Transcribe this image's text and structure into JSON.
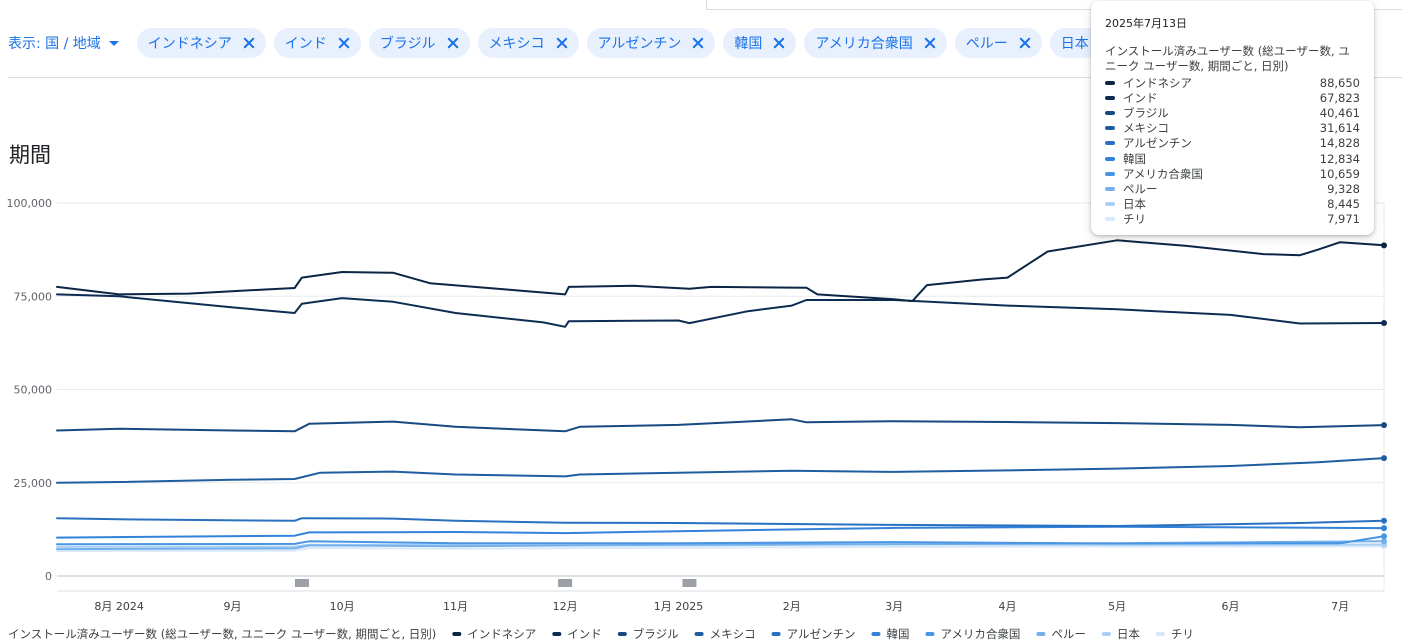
{
  "filter": {
    "dimension_label": "表示: 国 / 地域",
    "chips": [
      "インドネシア",
      "インド",
      "ブラジル",
      "メキシコ",
      "アルゼンチン",
      "韓国",
      "アメリカ合衆国",
      "ペルー",
      "日本"
    ]
  },
  "section_title": "期間",
  "tooltip": {
    "date": "2025年7月13日",
    "metric": "インストール済みユーザー数 (総ユーザー数, ユニーク ユーザー数, 期間ごと, 日別)",
    "rows": [
      {
        "name": "インドネシア",
        "value": "88,650",
        "color": "#0b2545"
      },
      {
        "name": "インド",
        "value": "67,823",
        "color": "#0d2c54"
      },
      {
        "name": "ブラジル",
        "value": "40,461",
        "color": "#174a80"
      },
      {
        "name": "メキシコ",
        "value": "31,614",
        "color": "#1f5da0"
      },
      {
        "name": "アルゼンチン",
        "value": "14,828",
        "color": "#2a70c0"
      },
      {
        "name": "韓国",
        "value": "12,834",
        "color": "#3182d8"
      },
      {
        "name": "アメリカ合衆国",
        "value": "10,659",
        "color": "#4a95e3"
      },
      {
        "name": "ペルー",
        "value": "9,328",
        "color": "#74b0ec"
      },
      {
        "name": "日本",
        "value": "8,445",
        "color": "#a9cff4"
      },
      {
        "name": "チリ",
        "value": "7,971",
        "color": "#d6e8fa"
      }
    ]
  },
  "chart_data": {
    "type": "line",
    "ylabel": "インストール済みユーザー数 (総ユーザー数, ユニーク ユーザー数, 期間ごと, 日別)",
    "ylim": [
      0,
      100000
    ],
    "yticks": [
      0,
      25000,
      50000,
      75000,
      100000
    ],
    "ytick_labels": [
      "0",
      "25,000",
      "50,000",
      "75,000",
      "100,000"
    ],
    "xlim": [
      "2024-07-15",
      "2025-07-13"
    ],
    "xticks": [
      "2024-08-01",
      "2024-09-01",
      "2024-10-01",
      "2024-11-01",
      "2024-12-01",
      "2025-01-01",
      "2025-02-01",
      "2025-03-01",
      "2025-04-01",
      "2025-05-01",
      "2025-06-01",
      "2025-07-01"
    ],
    "xtick_labels": [
      "8月 2024",
      "9月",
      "10月",
      "11月",
      "12月",
      "1月 2025",
      "2月",
      "3月",
      "4月",
      "5月",
      "6月",
      "7月"
    ],
    "annotation_dates": [
      "2024-09-20",
      "2024-12-01",
      "2025-01-04"
    ],
    "grid": true,
    "legend_position": "bottom",
    "series": [
      {
        "name": "インドネシア",
        "color": "#0b2545",
        "x": [
          "2024-07-15",
          "2024-08-01",
          "2024-08-20",
          "2024-09-10",
          "2024-09-18",
          "2024-09-20",
          "2024-10-01",
          "2024-10-15",
          "2024-10-25",
          "2024-11-15",
          "2024-12-01",
          "2024-12-02",
          "2024-12-20",
          "2025-01-04",
          "2025-01-10",
          "2025-02-05",
          "2025-02-08",
          "2025-03-01",
          "2025-03-06",
          "2025-03-10",
          "2025-03-25",
          "2025-04-01",
          "2025-04-12",
          "2025-05-01",
          "2025-05-20",
          "2025-06-10",
          "2025-06-20",
          "2025-06-25",
          "2025-07-01",
          "2025-07-13"
        ],
        "values": [
          77500,
          75500,
          75700,
          76800,
          77200,
          80000,
          81500,
          81300,
          78500,
          76800,
          75500,
          77500,
          77800,
          77000,
          77500,
          77300,
          75500,
          74200,
          73700,
          78000,
          79500,
          80000,
          87000,
          90000,
          88500,
          86300,
          86000,
          87500,
          89500,
          88650
        ]
      },
      {
        "name": "インド",
        "color": "#0d2c54",
        "x": [
          "2024-07-15",
          "2024-08-01",
          "2024-09-01",
          "2024-09-18",
          "2024-09-20",
          "2024-10-01",
          "2024-10-15",
          "2024-11-01",
          "2024-11-25",
          "2024-12-01",
          "2024-12-02",
          "2025-01-01",
          "2025-01-04",
          "2025-01-20",
          "2025-02-01",
          "2025-02-05",
          "2025-03-01",
          "2025-04-01",
          "2025-05-01",
          "2025-06-01",
          "2025-06-20",
          "2025-07-13"
        ],
        "values": [
          75500,
          75000,
          72000,
          70500,
          73000,
          74500,
          73500,
          70500,
          68000,
          66800,
          68300,
          68500,
          67800,
          71000,
          72500,
          74000,
          74000,
          72500,
          71500,
          70000,
          67700,
          67823
        ]
      },
      {
        "name": "ブラジル",
        "color": "#174a80",
        "x": [
          "2024-07-15",
          "2024-08-01",
          "2024-09-01",
          "2024-09-18",
          "2024-09-22",
          "2024-10-15",
          "2024-11-01",
          "2024-12-01",
          "2024-12-05",
          "2025-01-01",
          "2025-02-01",
          "2025-02-05",
          "2025-03-01",
          "2025-04-01",
          "2025-05-01",
          "2025-06-01",
          "2025-06-20",
          "2025-07-13"
        ],
        "values": [
          39000,
          39500,
          39000,
          38800,
          40800,
          41400,
          40000,
          38800,
          40000,
          40500,
          42000,
          41200,
          41500,
          41300,
          41000,
          40500,
          39900,
          40461
        ]
      },
      {
        "name": "メキシコ",
        "color": "#1f5da0",
        "x": [
          "2024-07-15",
          "2024-08-01",
          "2024-09-01",
          "2024-09-18",
          "2024-09-25",
          "2024-10-15",
          "2024-11-01",
          "2024-12-01",
          "2024-12-05",
          "2025-01-01",
          "2025-02-01",
          "2025-03-01",
          "2025-04-01",
          "2025-05-01",
          "2025-06-01",
          "2025-06-25",
          "2025-07-13"
        ],
        "values": [
          25000,
          25200,
          25800,
          26000,
          27700,
          28000,
          27200,
          26700,
          27200,
          27700,
          28200,
          27900,
          28300,
          28800,
          29500,
          30500,
          31614
        ]
      },
      {
        "name": "アルゼンチン",
        "color": "#2a70c0",
        "x": [
          "2024-07-15",
          "2024-08-01",
          "2024-09-18",
          "2024-09-20",
          "2024-10-15",
          "2024-11-01",
          "2024-12-01",
          "2025-01-01",
          "2025-03-01",
          "2025-05-01",
          "2025-06-20",
          "2025-07-13"
        ],
        "values": [
          15500,
          15200,
          14800,
          15500,
          15400,
          14800,
          14300,
          14200,
          13700,
          13400,
          14200,
          14828
        ]
      },
      {
        "name": "韓国",
        "color": "#3182d8",
        "x": [
          "2024-07-15",
          "2024-09-18",
          "2024-09-22",
          "2024-11-01",
          "2024-12-01",
          "2025-01-01",
          "2025-03-01",
          "2025-05-01",
          "2025-07-13"
        ],
        "values": [
          10300,
          10800,
          11700,
          11800,
          11500,
          12000,
          12900,
          13200,
          12834
        ]
      },
      {
        "name": "アメリカ合衆国",
        "color": "#4a95e3",
        "x": [
          "2024-07-15",
          "2024-09-18",
          "2024-09-22",
          "2024-11-01",
          "2025-01-01",
          "2025-03-01",
          "2025-05-01",
          "2025-07-01",
          "2025-07-13"
        ],
        "values": [
          8500,
          8600,
          9300,
          8800,
          8800,
          9100,
          8700,
          8800,
          10659
        ]
      },
      {
        "name": "ペルー",
        "color": "#74b0ec",
        "x": [
          "2024-07-15",
          "2024-09-18",
          "2024-09-22",
          "2024-11-01",
          "2025-01-01",
          "2025-03-01",
          "2025-05-01",
          "2025-07-13"
        ],
        "values": [
          7200,
          7400,
          8200,
          8000,
          8400,
          8500,
          8800,
          9328
        ]
      },
      {
        "name": "日本",
        "color": "#a9cff4",
        "x": [
          "2024-07-15",
          "2024-09-18",
          "2024-09-22",
          "2024-11-01",
          "2025-01-01",
          "2025-03-01",
          "2025-05-01",
          "2025-07-13"
        ],
        "values": [
          7800,
          7900,
          8400,
          8300,
          8200,
          8500,
          8400,
          8445
        ]
      },
      {
        "name": "チリ",
        "color": "#d6e8fa",
        "x": [
          "2024-07-15",
          "2024-09-18",
          "2024-09-22",
          "2024-11-01",
          "2025-01-01",
          "2025-03-01",
          "2025-05-01",
          "2025-07-13"
        ],
        "values": [
          6700,
          6800,
          7500,
          7300,
          7600,
          7800,
          7900,
          7971
        ]
      }
    ]
  }
}
